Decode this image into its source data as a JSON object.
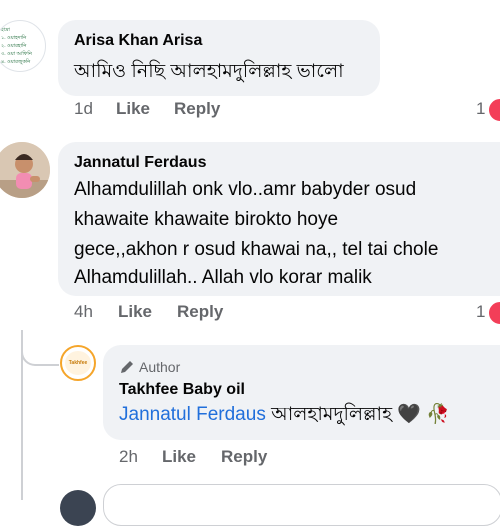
{
  "comments": [
    {
      "author": "Arisa Khan Arisa",
      "text": "আমিও নিছি আলহামদুলিল্লাহ ভালো",
      "time": "1d",
      "like_label": "Like",
      "reply_label": "Reply",
      "reaction_count": "1",
      "avatar_lines": [
        "হাদ্রা",
        "১. ওয়াহদানি",
        "২. ওয়ারহানি",
        "৩. ওয়া আফিনি",
        "৪. ওয়ারজুকনি"
      ]
    },
    {
      "author": "Jannatul Ferdaus",
      "text_lines": [
        "Alhamdulillah onk vlo..amr babyder osud",
        "khawaite khawaite birokto hoye",
        "gece,,akhon r osud khawai na,, tel tai chole",
        "Alhamdulillah.. Allah vlo korar malik"
      ],
      "time": "4h",
      "like_label": "Like",
      "reply_label": "Reply",
      "reaction_count": "1"
    }
  ],
  "reply": {
    "badge": "Author",
    "author": "Takhfee Baby oil",
    "mention": "Jannatul Ferdaus",
    "text": "আলহামদুলিল্লাহ",
    "emoji": "🖤 🥀",
    "logo_text": "Takhfee",
    "time": "2h",
    "like_label": "Like",
    "reply_label": "Reply"
  },
  "colors": {
    "bubble": "#f0f2f5",
    "secondary_text": "#65676b",
    "mention": "#216fdb",
    "reaction": "#f33e58",
    "logo": "#f5a52a"
  }
}
